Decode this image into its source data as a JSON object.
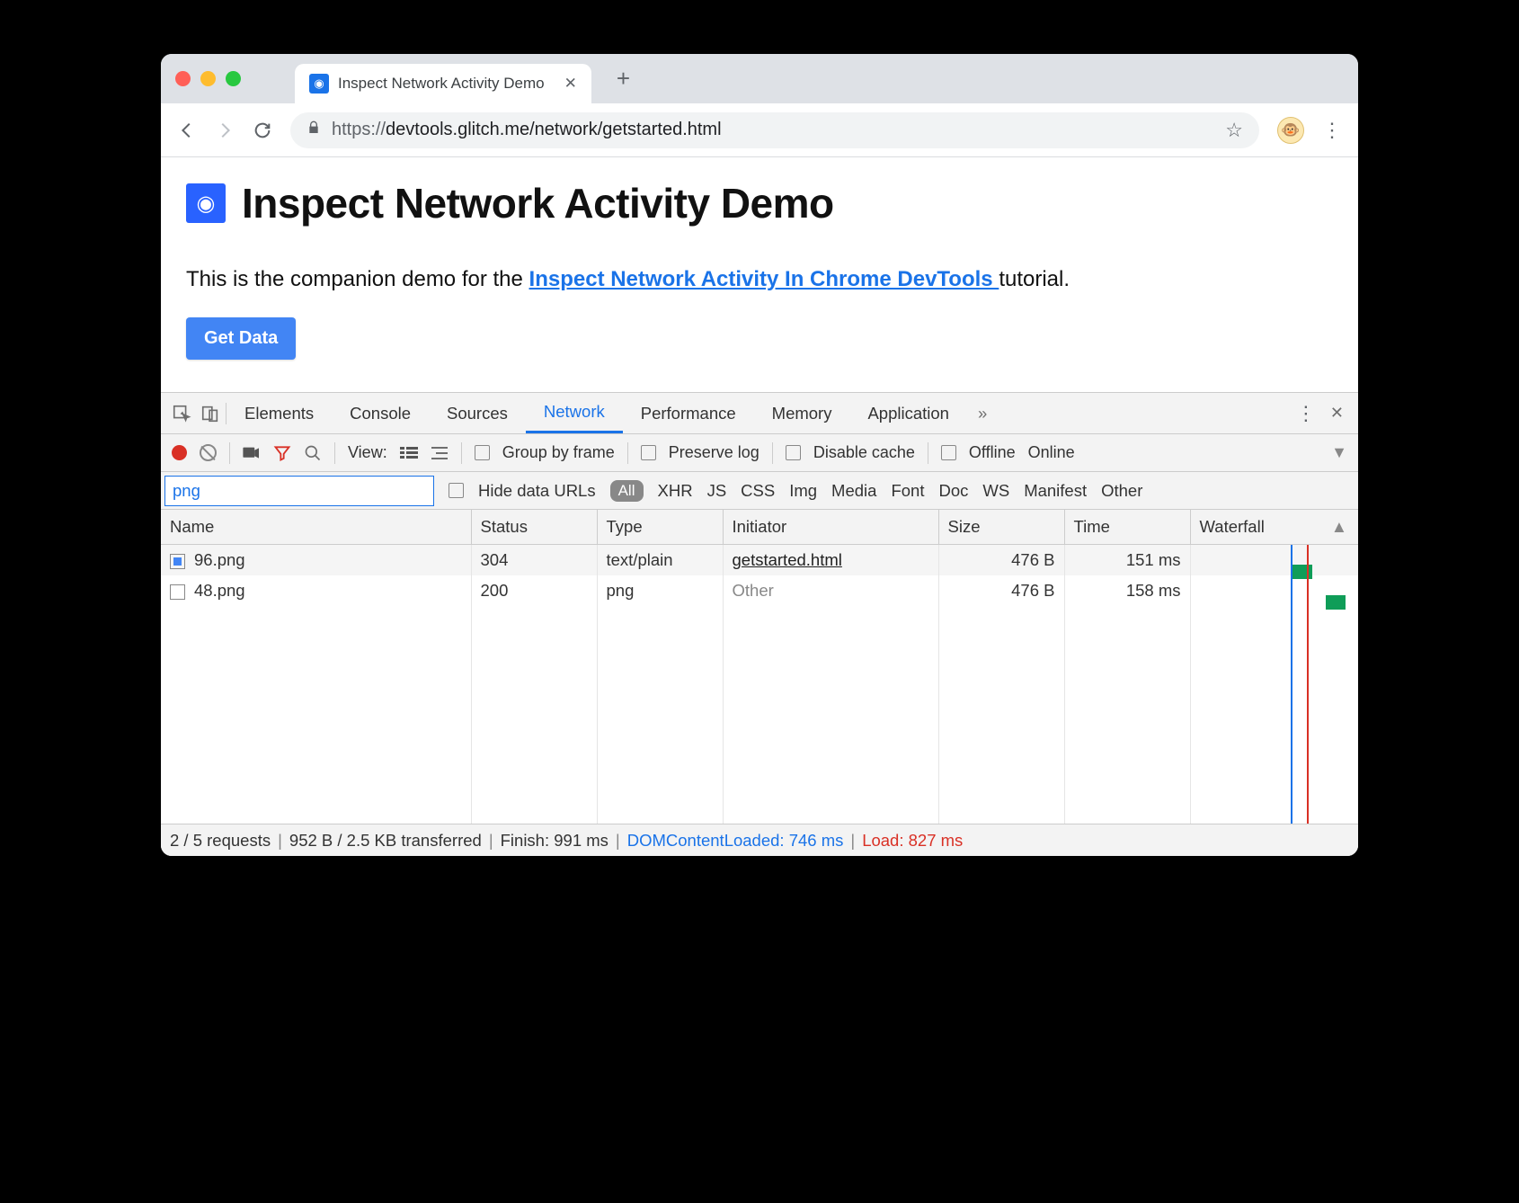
{
  "browser": {
    "tab_title": "Inspect Network Activity Demo",
    "url_scheme": "https://",
    "url_rest": "devtools.glitch.me/network/getstarted.html"
  },
  "page": {
    "heading": "Inspect Network Activity Demo",
    "intro_before": "This is the companion demo for the ",
    "intro_link": "Inspect Network Activity In Chrome DevTools ",
    "intro_after": "tutorial.",
    "button": "Get Data"
  },
  "devtools": {
    "tabs": [
      "Elements",
      "Console",
      "Sources",
      "Network",
      "Performance",
      "Memory",
      "Application"
    ],
    "active_tab": "Network",
    "toolbar": {
      "view_label": "View:",
      "group_by_frame": "Group by frame",
      "preserve_log": "Preserve log",
      "disable_cache": "Disable cache",
      "offline": "Offline",
      "online": "Online"
    },
    "filter_value": "png",
    "hide_data_urls": "Hide data URLs",
    "type_all": "All",
    "type_filters": [
      "XHR",
      "JS",
      "CSS",
      "Img",
      "Media",
      "Font",
      "Doc",
      "WS",
      "Manifest",
      "Other"
    ],
    "columns": [
      "Name",
      "Status",
      "Type",
      "Initiator",
      "Size",
      "Time",
      "Waterfall"
    ],
    "rows": [
      {
        "name": "96.png",
        "status": "304",
        "type": "text/plain",
        "initiator": "getstarted.html",
        "initiator_link": true,
        "size": "476 B",
        "time": "151 ms",
        "icon_filled": true
      },
      {
        "name": "48.png",
        "status": "200",
        "type": "png",
        "initiator": "Other",
        "initiator_link": false,
        "size": "476 B",
        "time": "158 ms",
        "icon_filled": false
      }
    ],
    "status": {
      "requests": "2 / 5 requests",
      "transferred": "952 B / 2.5 KB transferred",
      "finish": "Finish: 991 ms",
      "dcl": "DOMContentLoaded: 746 ms",
      "load": "Load: 827 ms"
    }
  }
}
